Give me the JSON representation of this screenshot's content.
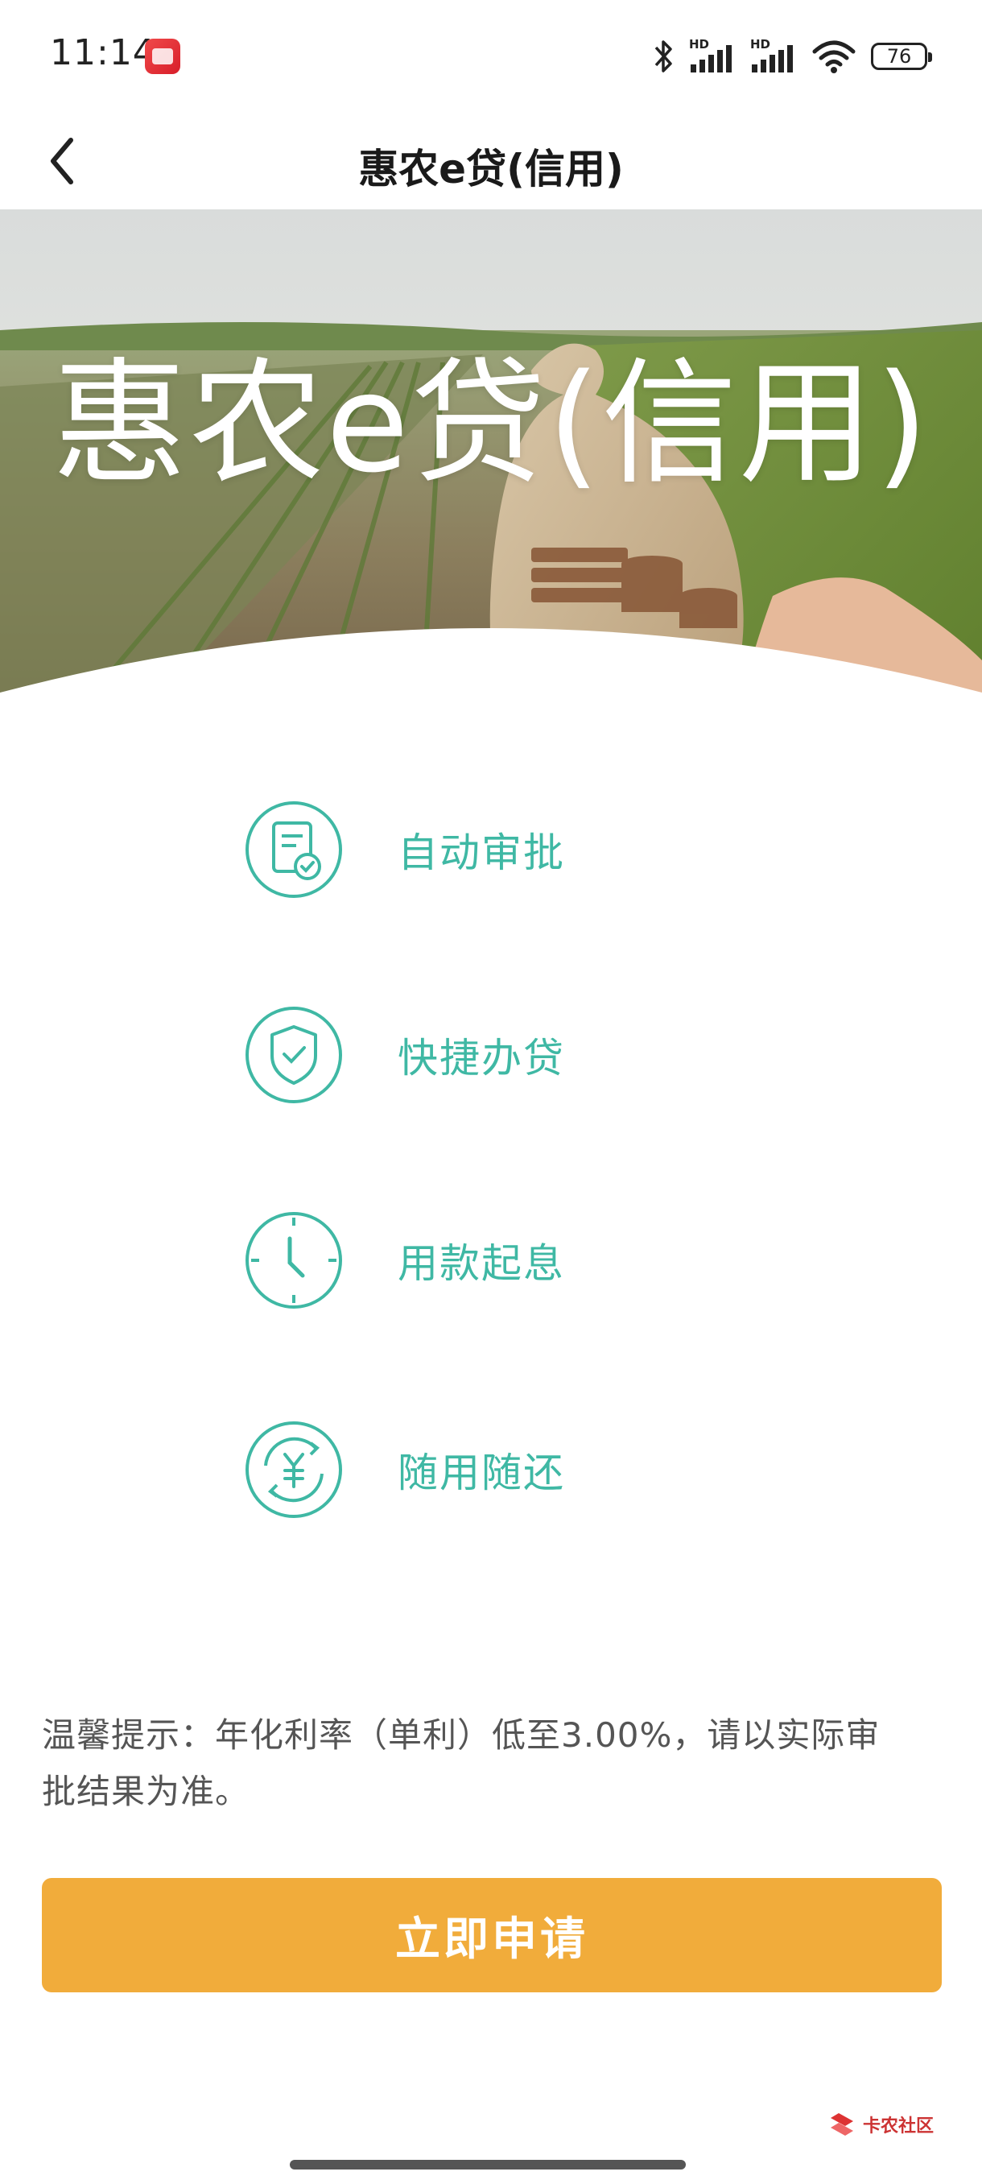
{
  "status_bar": {
    "time": "11:14",
    "notification_icon": "app-notification-icon",
    "network_label_1": "HD",
    "network_label_2": "HD",
    "battery": "76"
  },
  "nav": {
    "title": "惠农e贷(信用)",
    "back_icon": "chevron-left-icon"
  },
  "hero": {
    "title": "惠农e贷(信用)"
  },
  "features": [
    {
      "label": "自动审批",
      "icon": "document-check-icon"
    },
    {
      "label": "快捷办贷",
      "icon": "shield-check-icon"
    },
    {
      "label": "用款起息",
      "icon": "clock-icon"
    },
    {
      "label": "随用随还",
      "icon": "yuan-cycle-icon"
    }
  ],
  "tip": {
    "line1": "温馨提示：年化利率（单利）低至3.00%，请以实际审",
    "line2": "批结果为准。"
  },
  "apply_button": {
    "label": "立即申请"
  },
  "watermark": {
    "text": "卡农社区"
  },
  "colors": {
    "accent_teal": "#3fb8a4",
    "button_orange": "#f1ac3b"
  }
}
